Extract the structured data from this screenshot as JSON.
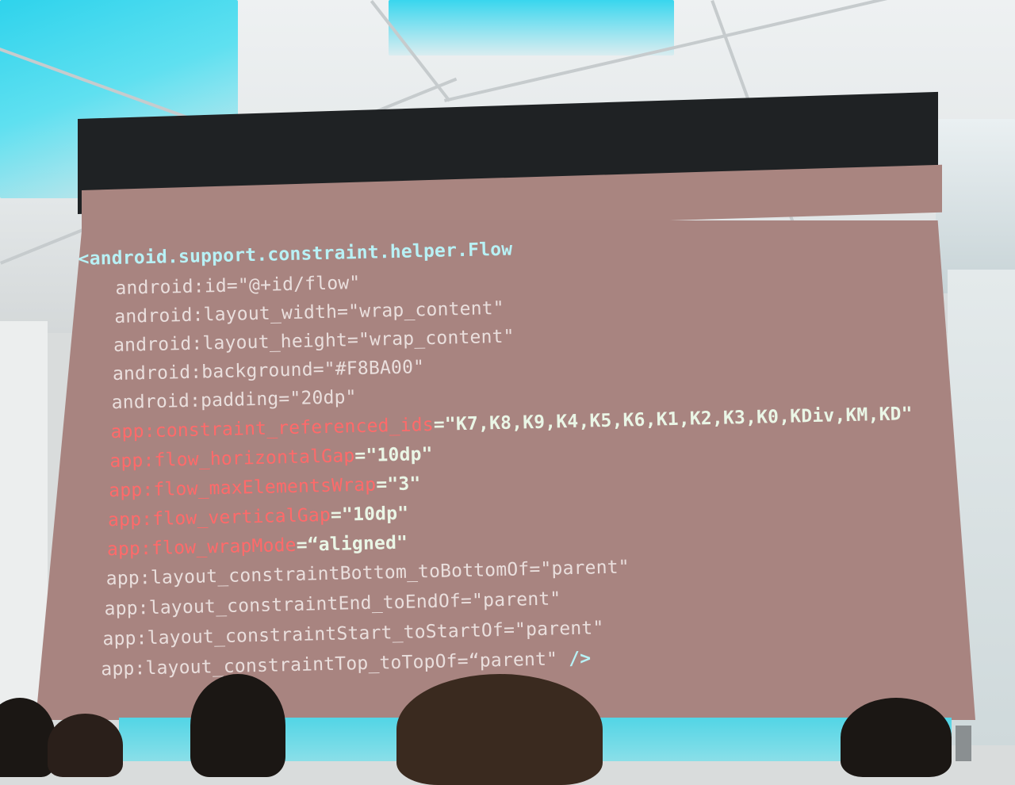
{
  "slide": {
    "code_lines": [
      {
        "key": "l1",
        "a": "<android.support.constraint.helper.Flow",
        "b": "",
        "style": "tag"
      },
      {
        "key": "l2",
        "a": "android:id=\"@+id/flow\"",
        "b": "",
        "style": "plain"
      },
      {
        "key": "l3",
        "a": "android:layout_width=\"wrap_content\"",
        "b": "",
        "style": "plain"
      },
      {
        "key": "l4",
        "a": "android:layout_height=\"wrap_content\"",
        "b": "",
        "style": "plain"
      },
      {
        "key": "l5",
        "a": "android:background=\"#F8BA00\"",
        "b": "",
        "style": "plain"
      },
      {
        "key": "l6",
        "a": "android:padding=\"20dp\"",
        "b": "",
        "style": "plain"
      },
      {
        "key": "l7",
        "a": "app:constraint_referenced_ids",
        "b": "=\"K7,K8,K9,K4,K5,K6,K1,K2,K3,K0,KDiv,KM,KD\"",
        "style": "highlight"
      },
      {
        "key": "l8",
        "a": "app:flow_horizontalGap",
        "b": "=\"10dp\"",
        "style": "highlight"
      },
      {
        "key": "l9",
        "a": "app:flow_maxElementsWrap",
        "b": "=\"3\"",
        "style": "highlight"
      },
      {
        "key": "l10",
        "a": "app:flow_verticalGap",
        "b": "=\"10dp\"",
        "style": "highlight"
      },
      {
        "key": "l11",
        "a": "app:flow_wrapMode",
        "b": "=“aligned\"",
        "style": "highlight"
      },
      {
        "key": "l12",
        "a": "app:layout_constraintBottom_toBottomOf=\"parent\"",
        "b": "",
        "style": "plain"
      },
      {
        "key": "l13",
        "a": "app:layout_constraintEnd_toEndOf=\"parent\"",
        "b": "",
        "style": "plain"
      },
      {
        "key": "l14",
        "a": "app:layout_constraintStart_toStartOf=\"parent\"",
        "b": "",
        "style": "plain"
      },
      {
        "key": "l15",
        "a": "app:layout_constraintTop_toTopOf=“parent\"",
        "b": " />",
        "style": "plain-close"
      }
    ]
  },
  "colors": {
    "screen_background": "#a88480",
    "tag_text": "#b8f1f5",
    "attribute_highlight": "#ff6a6a",
    "plain_text": "#eadfdd",
    "stage_light": "#52d5e6"
  }
}
